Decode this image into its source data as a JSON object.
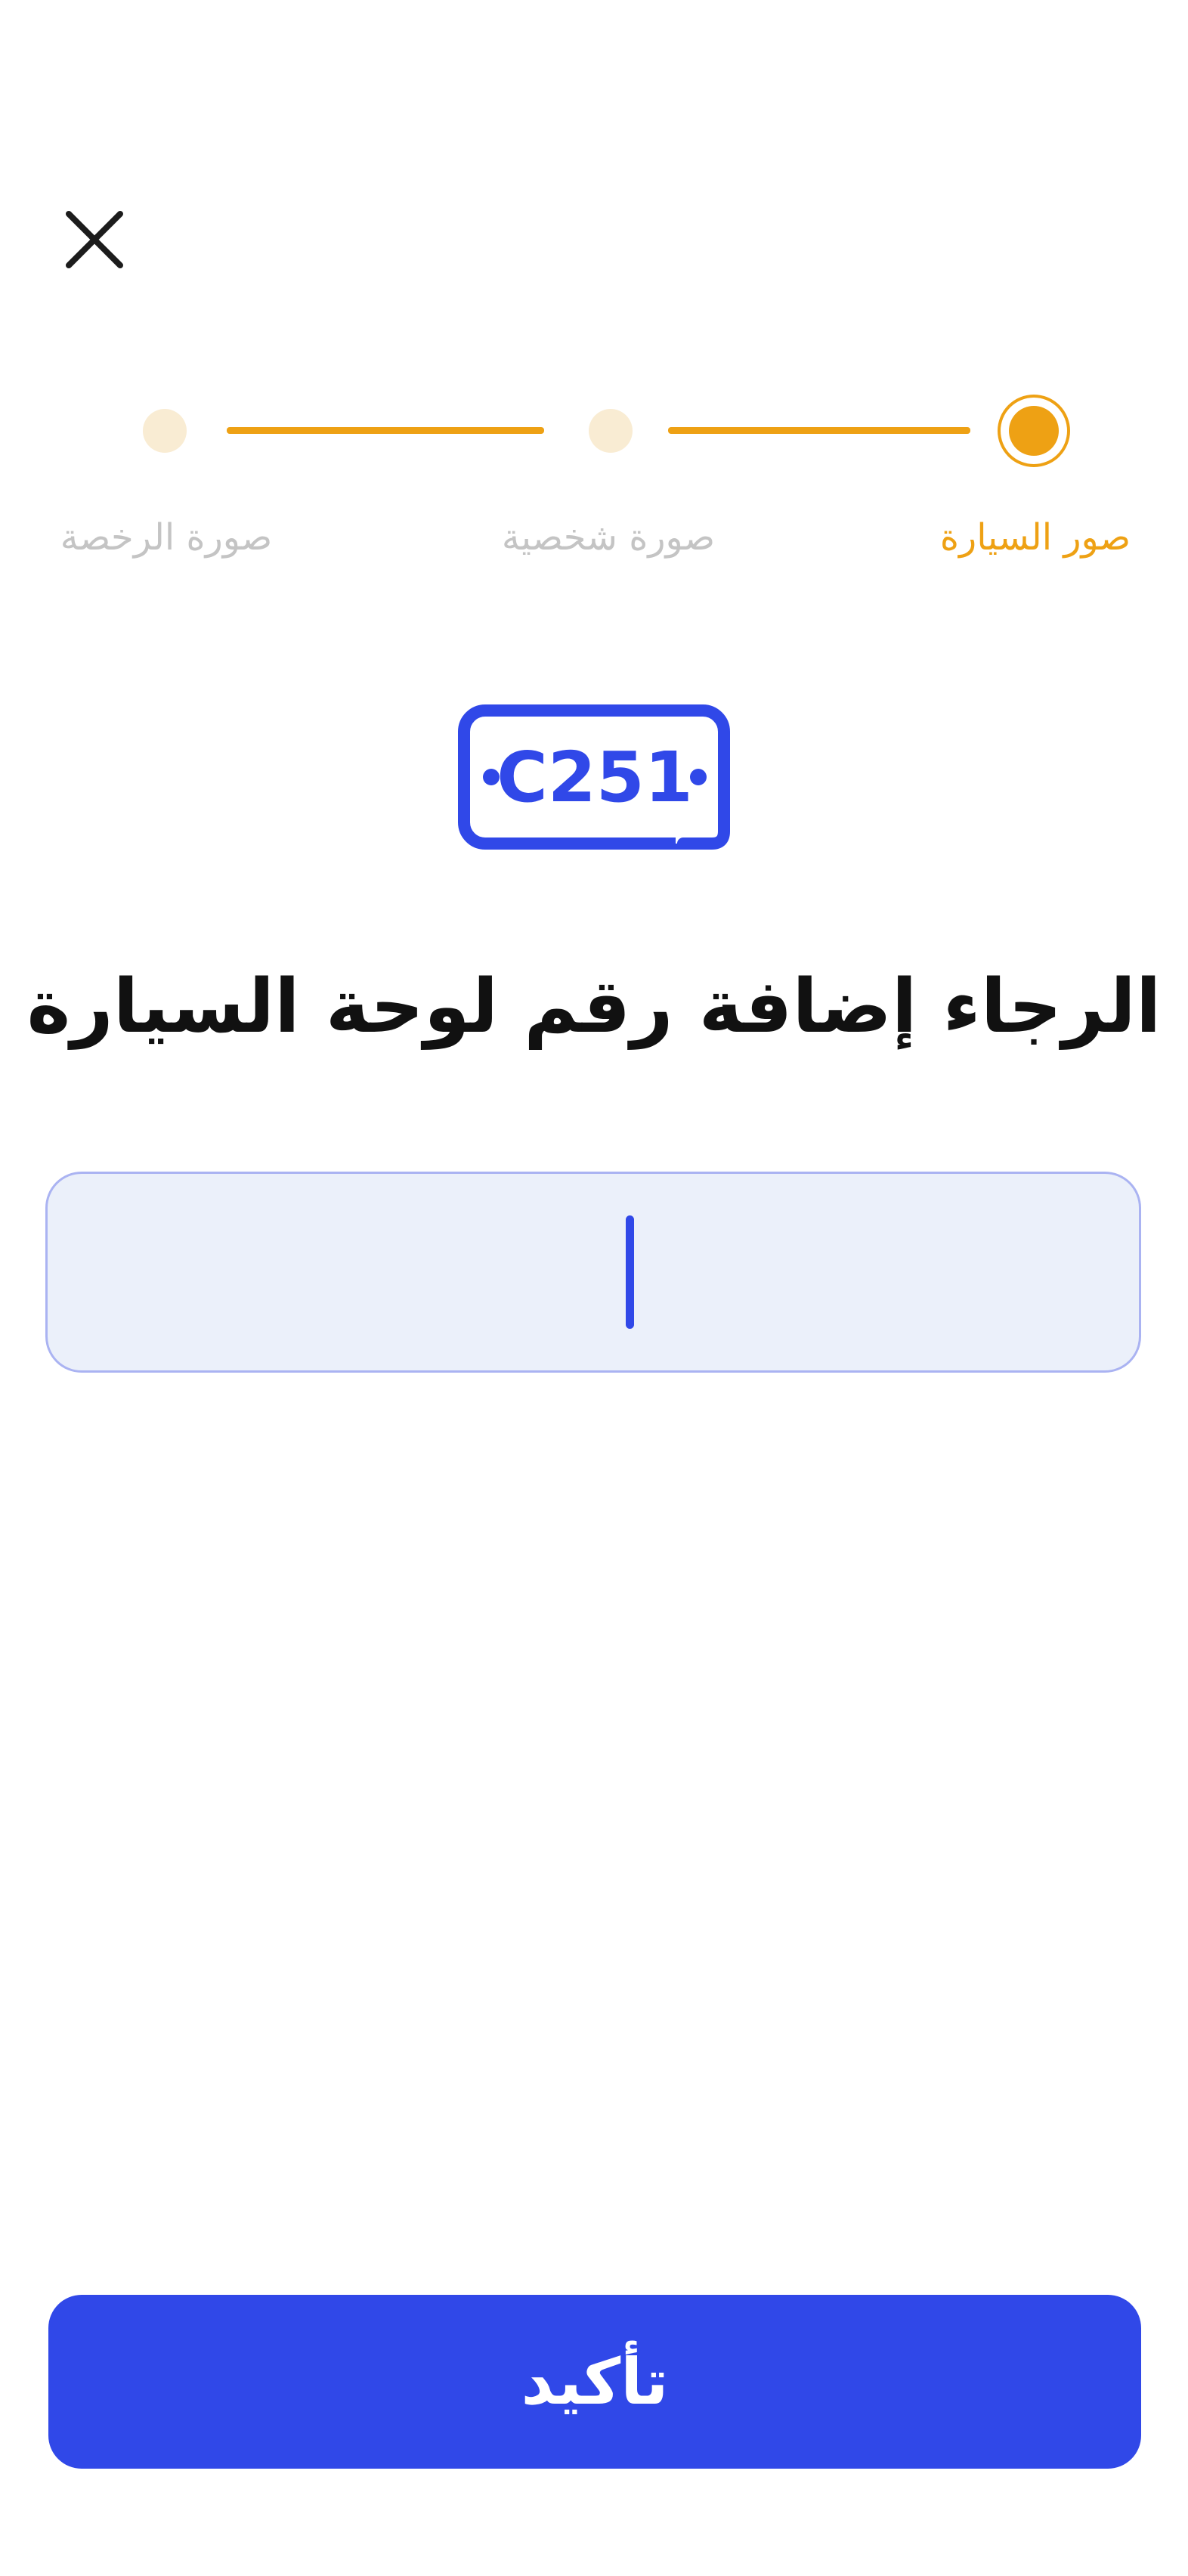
{
  "header": {
    "close_icon": "close-icon"
  },
  "stepper": {
    "steps": [
      {
        "label": "صور السيارة",
        "state": "active"
      },
      {
        "label": "صورة شخصية",
        "state": "upcoming"
      },
      {
        "label": "صورة الرخصة",
        "state": "upcoming"
      }
    ],
    "colors": {
      "active": "#eea114",
      "inactive_dot": "#f9ecd3",
      "inactive_label": "#c4c4c4"
    }
  },
  "plate_icon": {
    "icon": "license-plate-icon",
    "text": "C251",
    "color": "#3048e8"
  },
  "main": {
    "title": "الرجاء إضافة رقم لوحة السيارة",
    "input": {
      "value": "",
      "placeholder": ""
    }
  },
  "footer": {
    "confirm_label": "تأكيد",
    "accent": "#3048e8"
  }
}
